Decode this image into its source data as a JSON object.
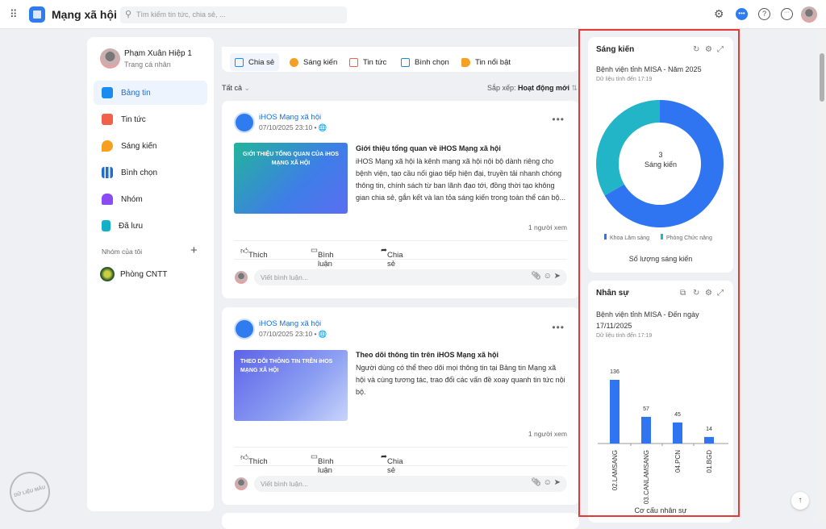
{
  "app": {
    "title": "Mạng xã hội",
    "search_placeholder": "Tìm kiếm tin tức, chia sẻ, ..."
  },
  "user": {
    "name": "Phạm Xuân Hiệp 1",
    "subtitle": "Trang cá nhân"
  },
  "sidebar": {
    "items": [
      {
        "label": "Bảng tin",
        "color": "#1a8cf0"
      },
      {
        "label": "Tin tức",
        "color": "#f0604a"
      },
      {
        "label": "Sáng kiến",
        "color": "#f5a020"
      },
      {
        "label": "Bình chọn",
        "color": "#1e6fc8"
      },
      {
        "label": "Nhóm",
        "color": "#8a4cf0"
      },
      {
        "label": "Đã lưu",
        "color": "#14b0c8"
      }
    ],
    "groups_label": "Nhóm của tôi",
    "groups": [
      {
        "label": "Phòng CNTT"
      }
    ]
  },
  "composer": {
    "tabs": [
      {
        "label": "Chia sẻ",
        "color": "#1a8cf0"
      },
      {
        "label": "Sáng kiến",
        "color": "#f5a020"
      },
      {
        "label": "Tin tức",
        "color": "#f0604a"
      },
      {
        "label": "Bình chọn",
        "color": "#1e8cc8"
      },
      {
        "label": "Tin nổi bật",
        "color": "#f5a020"
      }
    ]
  },
  "feed": {
    "filter": "Tất cả",
    "sort_label": "Sắp xếp:",
    "sort_value": "Hoạt động mới",
    "posts": [
      {
        "author": "iHOS Mạng xã hội",
        "date": "07/10/2025 23:10",
        "thumb_text": "GIỚI THIỆU TỔNG QUAN CỦA iHOS MẠNG XÃ HỘI",
        "title": "Giới thiệu tổng quan về iHOS Mạng xã hội",
        "body": "iHOS Mạng xã hội là kênh mạng xã hội nội bộ dành riêng cho bệnh viện, tạo cầu nối giao tiếp hiện đại, truyền tải nhanh chóng thông tin, chính sách từ ban lãnh đạo tới, đồng thời tạo không gian chia sẻ, gắn kết và lan tỏa sáng kiến trong toàn thể cán bộ...",
        "views": "1 người xem"
      },
      {
        "author": "iHOS Mạng xã hội",
        "date": "07/10/2025 23:10",
        "thumb_text": "THEO DÕI THÔNG TIN TRÊN iHOS MẠNG XÃ HỘI",
        "title": "Theo dõi thông tin trên iHOS Mạng xã hội",
        "body": "Người dùng có thể theo dõi mọi thông tin tại Bảng tin Mạng xã hội và cùng tương tác, trao đổi các vấn đề xoay quanh tin tức nội bộ.",
        "views": "1 người xem"
      }
    ],
    "like": "Thích",
    "comment": "Bình luận",
    "share": "Chia sẻ",
    "comment_placeholder": "Viết bình luận..."
  },
  "watermark": "DỮ LIỆU MẪU",
  "chart_data": [
    {
      "type": "pie",
      "title": "Sáng kiến",
      "subtitle": "Bệnh viện tỉnh MISA - Năm 2025",
      "updated": "Dữ liệu tính đến 17:19",
      "center_value": "3",
      "center_label": "Sáng kiến",
      "categories": [
        "Khoa Lâm sàng",
        "Phòng Chức năng"
      ],
      "values": [
        2,
        1
      ],
      "colors": [
        "#2f74f0",
        "#22b5c8"
      ],
      "xlabel": "Số lượng sáng kiến",
      "legend": "bottom"
    },
    {
      "type": "bar",
      "title": "Nhân sự",
      "subtitle": "Bệnh viện tỉnh MISA - Đến ngày 17/11/2025",
      "updated": "Dữ liệu tính đến 17:19",
      "categories": [
        "02.LAMSANG",
        "03.CANLAMSANG",
        "04.PCN",
        "01.BGD"
      ],
      "values": [
        136,
        57,
        45,
        14
      ],
      "color": "#2f74f0",
      "xlabel": "Cơ cấu nhân sự",
      "ylim": [
        0,
        136
      ]
    }
  ]
}
